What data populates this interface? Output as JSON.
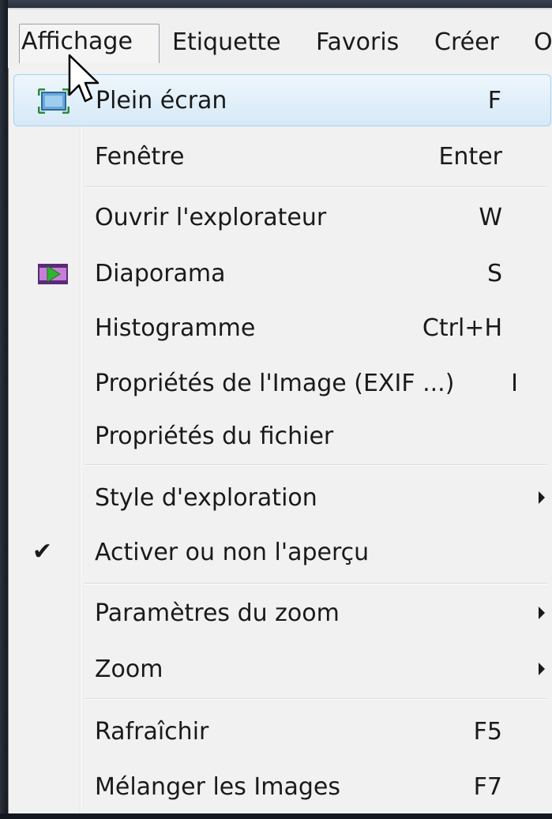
{
  "menubar": {
    "items": [
      {
        "label": "Affichage"
      },
      {
        "label": "Etiquette"
      },
      {
        "label": "Favoris"
      },
      {
        "label": "Créer"
      },
      {
        "label": "O"
      }
    ]
  },
  "dropdown": {
    "items": [
      {
        "label": "Plein écran",
        "shortcut": "F",
        "icon": "fullscreen-icon"
      },
      {
        "label": "Fenêtre",
        "shortcut": "Enter"
      },
      {
        "label": "Ouvrir l'explorateur",
        "shortcut": "W"
      },
      {
        "label": "Diaporama",
        "shortcut": "S",
        "icon": "slideshow-icon"
      },
      {
        "label": "Histogramme",
        "shortcut": "Ctrl+H"
      },
      {
        "label": "Propriétés de l'Image (EXIF ...)",
        "shortcut": "I"
      },
      {
        "label": "Propriétés du fichier",
        "shortcut": ""
      },
      {
        "label": "Style d'exploration",
        "submenu": true
      },
      {
        "label": "Activer ou non l'aperçu",
        "checked": true
      },
      {
        "label": "Paramètres du zoom",
        "submenu": true
      },
      {
        "label": "Zoom",
        "submenu": true
      },
      {
        "label": "Rafraîchir",
        "shortcut": "F5"
      },
      {
        "label": "Mélanger les Images",
        "shortcut": "F7"
      }
    ]
  },
  "colors": {
    "menu_bg": "#f1f1f1",
    "highlight_border": "#a8d1ee",
    "text": "#1a1a1a"
  }
}
